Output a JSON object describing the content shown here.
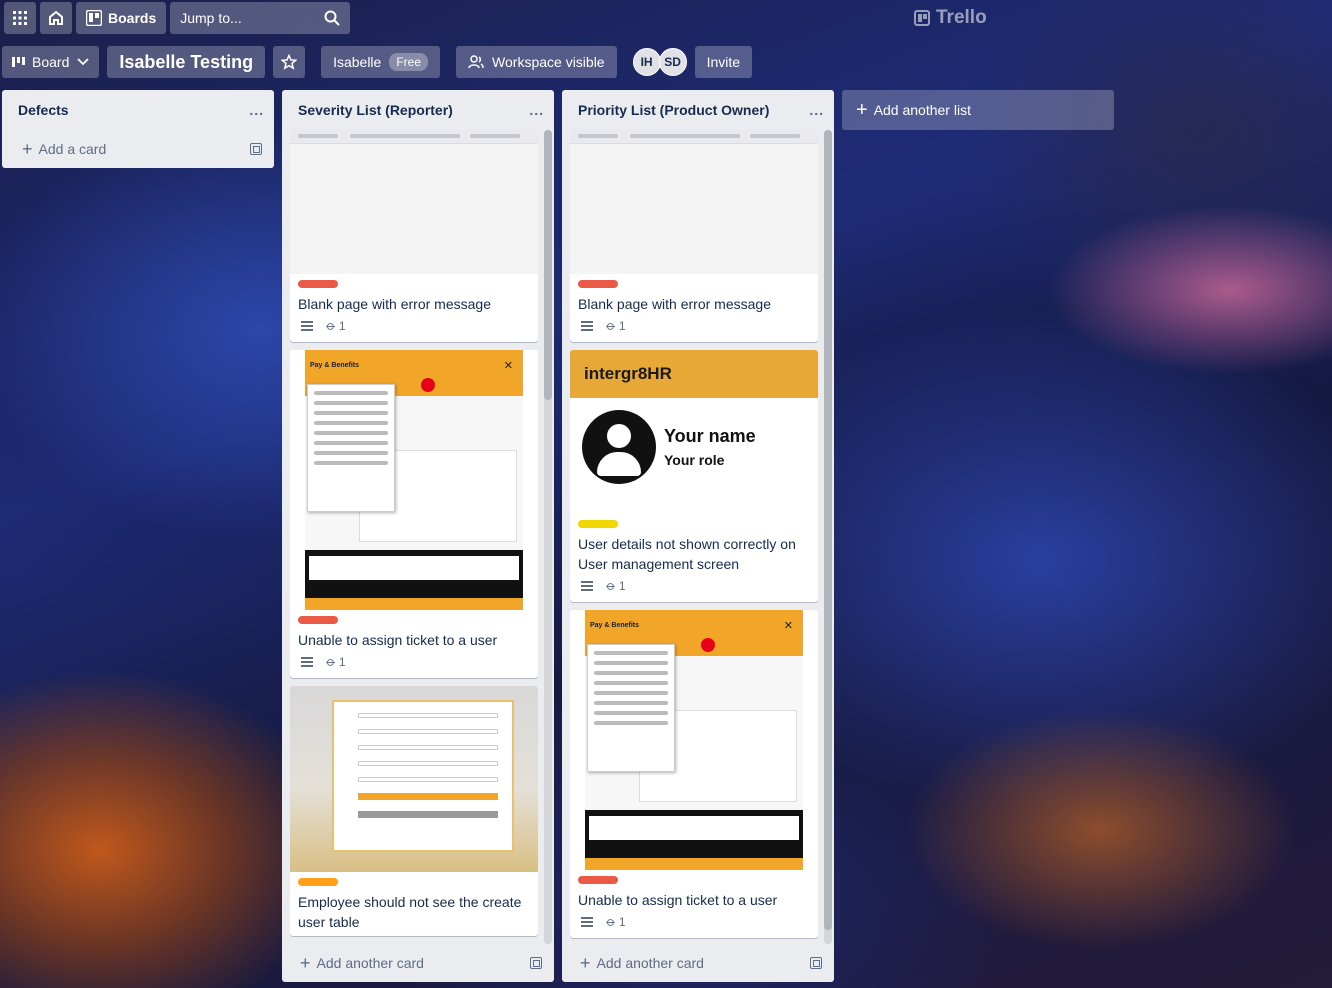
{
  "topbar": {
    "boards_label": "Boards",
    "search_placeholder": "Jump to...",
    "logo_text": "Trello"
  },
  "boardbar": {
    "view_label": "Board",
    "title": "Isabelle Testing",
    "workspace_name": "Isabelle",
    "plan_badge": "Free",
    "visibility_label": "Workspace visible",
    "members": [
      "IH",
      "SD"
    ],
    "invite_label": "Invite"
  },
  "lists": [
    {
      "title": "Defects",
      "menu": "...",
      "footer": "Add a card",
      "cards": []
    },
    {
      "title": "Severity List (Reporter)",
      "menu": "...",
      "footer": "Add another card",
      "cards": [
        {
          "title": "Blank page with error message",
          "label_color": "#eb5a46",
          "attachments": "1",
          "cover": "blank-page-screenshot"
        },
        {
          "title": "Unable to assign ticket to a user",
          "label_color": "#eb5a46",
          "attachments": "1",
          "cover": "pay-benefits-screenshot"
        },
        {
          "title": "Employee should not see the create user table",
          "label_color": "#ff9f1a",
          "attachments": "",
          "cover": "create-user-form-screenshot"
        }
      ]
    },
    {
      "title": "Priority List (Product Owner)",
      "menu": "...",
      "footer": "Add another card",
      "cards": [
        {
          "title": "Blank page with error message",
          "label_color": "#eb5a46",
          "attachments": "1",
          "cover": "blank-page-screenshot"
        },
        {
          "title": "User details not shown correctly on User management screen",
          "label_color": "#f2d600",
          "attachments": "1",
          "cover": "intergr8hr-profile-screenshot"
        },
        {
          "title": "Unable to assign ticket to a user",
          "label_color": "#eb5a46",
          "attachments": "1",
          "cover": "pay-benefits-screenshot"
        }
      ]
    }
  ],
  "add_list_label": "Add another list",
  "covers": {
    "pay_title": "Pay & Benefits",
    "hr_brand": "intergr8HR",
    "hr_name": "Your name",
    "hr_role": "Your role"
  },
  "colors": {
    "list_bg": "#ebecf0",
    "red_label": "#eb5a46",
    "orange_label": "#ff9f1a",
    "yellow_label": "#f2d600"
  }
}
